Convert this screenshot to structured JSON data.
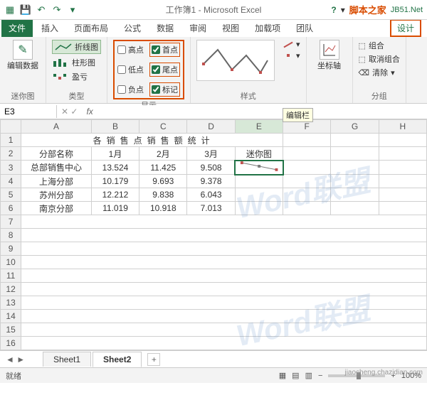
{
  "title": "工作簿1 - Microsoft Excel",
  "brand_cn": "脚本之家",
  "brand_site": "JB51.Net",
  "ribbon_tabs": {
    "file": "文件",
    "insert": "插入",
    "pagelayout": "页面布局",
    "formulas": "公式",
    "data": "数据",
    "review": "审阅",
    "view": "视图",
    "addins": "加载项",
    "team": "团队",
    "design": "设计"
  },
  "groups": {
    "sparkline": {
      "label": "迷你图",
      "editdata": "编辑数据"
    },
    "type": {
      "label": "类型",
      "line": "折线图",
      "column": "柱形图",
      "winloss": "盈亏"
    },
    "show": {
      "label": "显示",
      "highpoint": "高点",
      "firstpoint": "首点",
      "lowpoint": "低点",
      "lastpoint": "尾点",
      "negpoint": "负点",
      "markers": "标记"
    },
    "style": {
      "label": "样式"
    },
    "group": {
      "label": "分组",
      "axis": "坐标轴",
      "grp": "组合",
      "ungrp": "取消组合",
      "clear": "清除"
    }
  },
  "namebox": "E3",
  "formulabar_tip": "编辑栏",
  "columns": [
    "A",
    "B",
    "C",
    "D",
    "E",
    "F",
    "G",
    "H"
  ],
  "row_title": "各 销 售 点 销 售 额 统 计",
  "headers": {
    "name": "分部名称",
    "m1": "1月",
    "m2": "2月",
    "m3": "3月",
    "spark": "迷你图"
  },
  "rows": [
    {
      "name": "总部销售中心",
      "m1": "13.524",
      "m2": "11.425",
      "m3": "9.508"
    },
    {
      "name": "上海分部",
      "m1": "10.179",
      "m2": "9.693",
      "m3": "9.378"
    },
    {
      "name": "苏州分部",
      "m1": "12.212",
      "m2": "9.838",
      "m3": "6.043"
    },
    {
      "name": "南京分部",
      "m1": "11.019",
      "m2": "10.918",
      "m3": "7.013"
    }
  ],
  "chart_data": {
    "type": "line",
    "title": "总部销售中心 迷你图",
    "categories": [
      "1月",
      "2月",
      "3月"
    ],
    "values": [
      13.524,
      11.425,
      9.508
    ],
    "xlabel": "",
    "ylabel": "",
    "ylim": [
      9,
      14
    ]
  },
  "sheets": {
    "s1": "Sheet1",
    "s2": "Sheet2"
  },
  "status": {
    "ready": "就绪",
    "zoom": "100%"
  },
  "watermark": "Word联盟",
  "footer_wm": "jiaocheng.chazidian.com"
}
